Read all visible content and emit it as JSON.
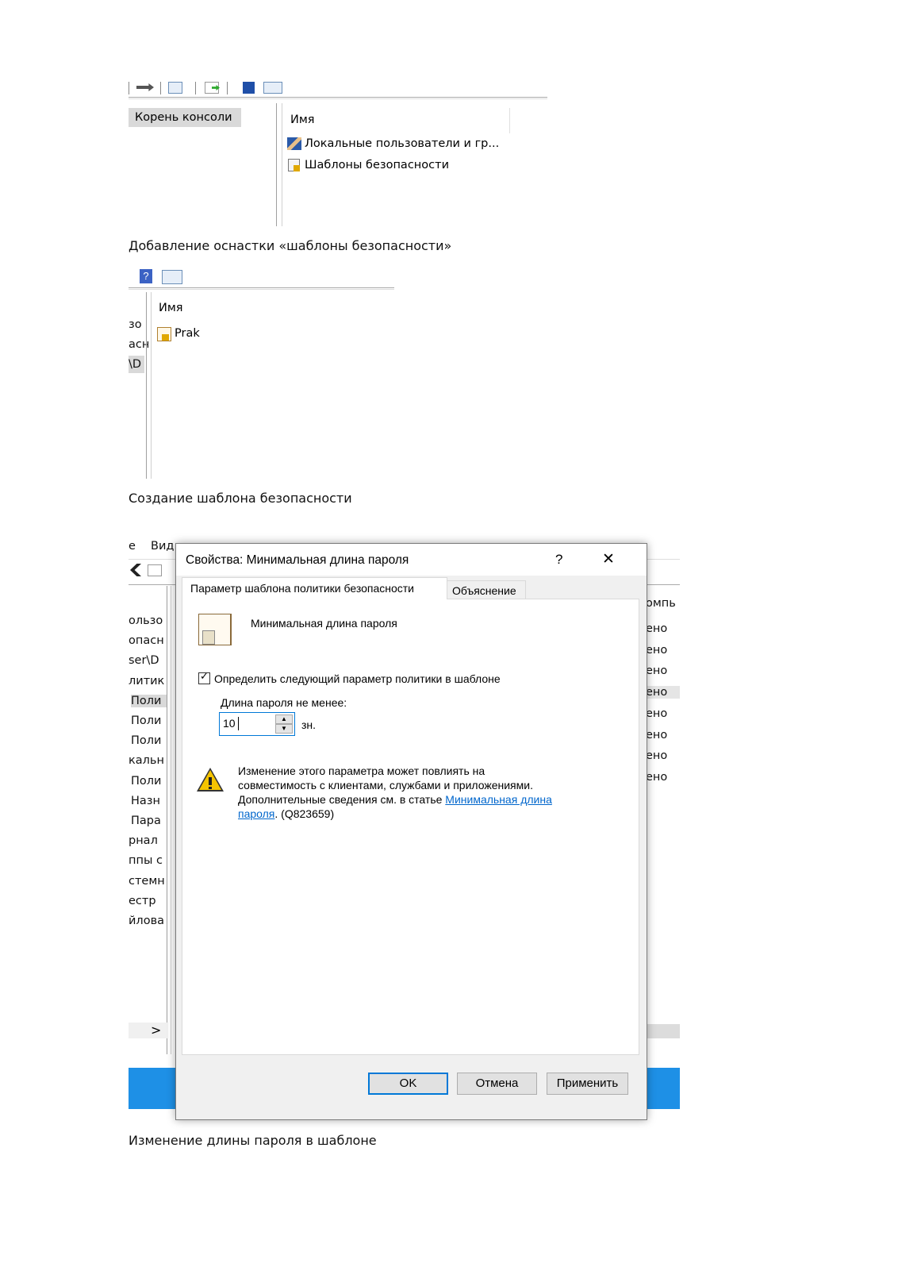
{
  "figure1": {
    "tree_root": "Корень консоли",
    "column_name": "Имя",
    "items": [
      "Локальные пользователи и гр...",
      "Шаблоны безопасности"
    ],
    "caption": "Добавление оснастки «шаблоны безопасности»"
  },
  "figure2": {
    "column_name": "Имя",
    "tree_fragments": [
      "зо",
      "асн",
      "\\D"
    ],
    "item": "Prak",
    "caption": "Создание шаблона безопасности"
  },
  "figure3": {
    "bg_menu": [
      "е",
      "Вид"
    ],
    "bg_left_fragments": [
      "ользо",
      "опасн",
      "ser\\D",
      "литик",
      "Поли",
      "Поли",
      "Поли",
      "кальн",
      "Поли",
      "Назн",
      "Пара",
      "рнал",
      "ппы с",
      "стемн",
      "естр",
      "йлова"
    ],
    "bg_right_header": "омпь",
    "bg_right_values": [
      "ено",
      "ено",
      "ено",
      "ено",
      "ено",
      "ено",
      "ено",
      "ено"
    ],
    "dialog": {
      "title": "Свойства: Минимальная длина пароля",
      "help_symbol": "?",
      "close_symbol": "✕",
      "tabs": [
        "Параметр шаблона политики безопасности",
        "Объяснение"
      ],
      "policy_name": "Минимальная длина пароля",
      "checkbox_label": "Определить следующий параметр политики в шаблоне",
      "checkbox_checked": true,
      "length_label": "Длина пароля не менее:",
      "length_value": "10",
      "unit": "зн.",
      "warning_text_1": "Изменение этого параметра может повлиять на",
      "warning_text_2": "совместимость с клиентами, службами и приложениями.",
      "warning_text_3": "Дополнительные сведения см. в статье ",
      "warning_link_1": "Минимальная длина",
      "warning_link_2": "пароля",
      "warning_text_4": ". (Q823659)",
      "buttons": {
        "ok": "OK",
        "cancel": "Отмена",
        "apply": "Применить"
      }
    },
    "caption": "Изменение длины пароля в шаблоне"
  },
  "colors": {
    "accent": "#0078d7",
    "link": "#0066cc",
    "taskbar": "#1e90e6",
    "dialog_bg": "#f0f0f0"
  }
}
